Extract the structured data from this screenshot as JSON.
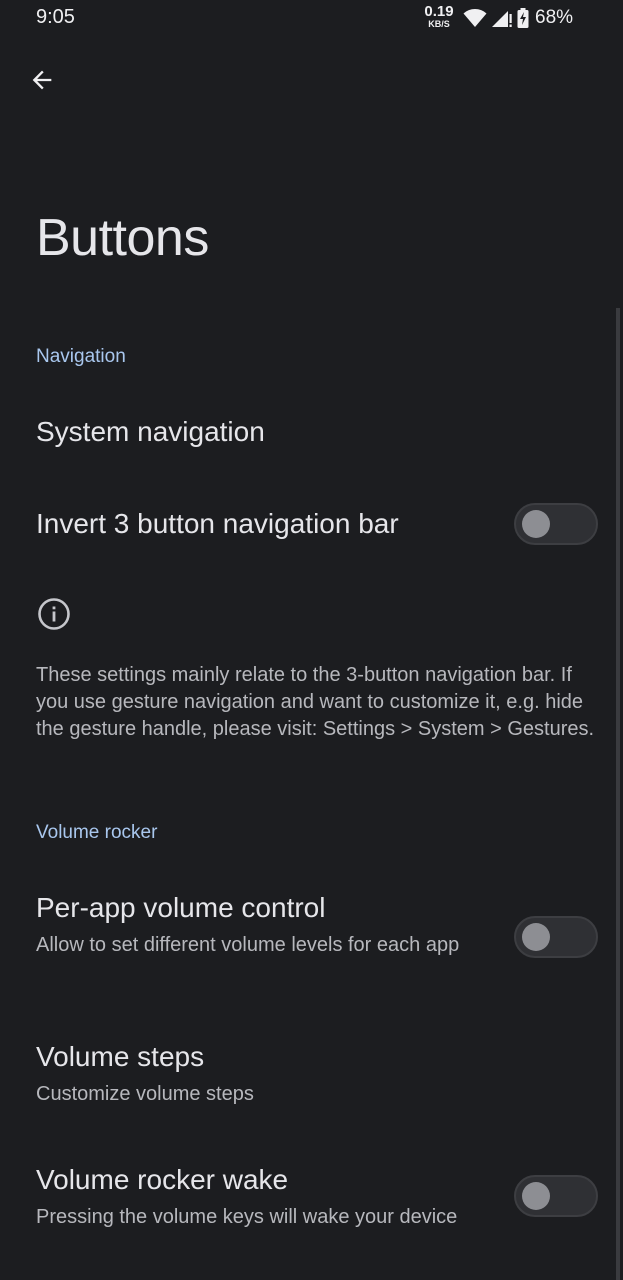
{
  "status_bar": {
    "time": "9:05",
    "net_speed_value": "0.19",
    "net_speed_unit": "KB/S",
    "battery": "68%",
    "icons": [
      "wifi-icon",
      "cell-signal-icon",
      "battery-charging-icon"
    ]
  },
  "header": {
    "back_icon": "arrow-back-icon",
    "title": "Buttons"
  },
  "sections": {
    "navigation": {
      "header": "Navigation",
      "system_navigation": "System navigation",
      "invert_bar": {
        "title": "Invert 3 button navigation bar",
        "enabled": false
      },
      "info_icon": "info-icon",
      "info_text": "These settings mainly relate to the 3-button navigation bar. If you use gesture navigation and want to customize it, e.g. hide the gesture handle, please visit: Settings > System > Gestures."
    },
    "volume_rocker": {
      "header": "Volume rocker",
      "per_app": {
        "title": "Per-app volume control",
        "summary": "Allow to set different volume levels for each app",
        "enabled": false
      },
      "volume_steps": {
        "title": "Volume steps",
        "summary": "Customize volume steps"
      },
      "rocker_wake": {
        "title": "Volume rocker wake",
        "summary": "Pressing the volume keys will wake your device",
        "enabled": false
      }
    }
  },
  "colors": {
    "background": "#1c1d20",
    "accent": "#a9c7ee",
    "primary_text": "#e6e6ea",
    "secondary_text": "#b7b8bd"
  }
}
